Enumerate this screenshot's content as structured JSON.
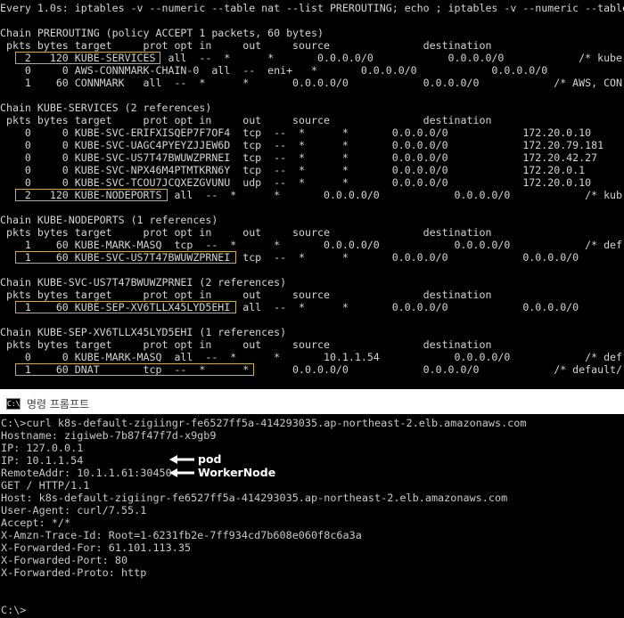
{
  "top_terminal": {
    "lines": [
      "Every 1.0s: iptables -v --numeric --table nat --list PREROUTING; echo ; iptables -v --numeric --table nat",
      "",
      "Chain PREROUTING (policy ACCEPT 1 packets, 60 bytes)",
      " pkts bytes target     prot opt in     out     source               destination",
      "    2   120 KUBE-SERVICES  all  --  *      *       0.0.0.0/0            0.0.0.0/0            /* kube",
      "    0     0 AWS-CONNMARK-CHAIN-0  all  --  eni+   *       0.0.0.0/0            0.0.0.0/0",
      "    1    60 CONNMARK   all  --  *      *       0.0.0.0/0            0.0.0.0/0            /* AWS, CON",
      "",
      "Chain KUBE-SERVICES (2 references)",
      " pkts bytes target     prot opt in     out     source               destination",
      "    0     0 KUBE-SVC-ERIFXISQEP7F7OF4  tcp  --  *      *       0.0.0.0/0            172.20.0.10",
      "    0     0 KUBE-SVC-UAGC4PYEYZJJEW6D  tcp  --  *      *       0.0.0.0/0            172.20.79.181",
      "    0     0 KUBE-SVC-US7T47BWUWZPRNEI  tcp  --  *      *       0.0.0.0/0            172.20.42.27",
      "    0     0 KUBE-SVC-NPX46M4PTMTKRN6Y  tcp  --  *      *       0.0.0.0/0            172.20.0.1",
      "    0     0 KUBE-SVC-TCOU7JCQXEZGVUNU  udp  --  *      *       0.0.0.0/0            172.20.0.10",
      "    2   120 KUBE-NODEPORTS  all  --  *      *       0.0.0.0/0            0.0.0.0/0            /* kub",
      "",
      "Chain KUBE-NODEPORTS (1 references)",
      " pkts bytes target     prot opt in     out     source               destination",
      "    1    60 KUBE-MARK-MASQ  tcp  --  *      *       0.0.0.0/0            0.0.0.0/0            /* def",
      "    1    60 KUBE-SVC-US7T47BWUWZPRNEI  tcp  --  *      *       0.0.0.0/0            0.0.0.0/0",
      "",
      "Chain KUBE-SVC-US7T47BWUWZPRNEI (2 references)",
      " pkts bytes target     prot opt in     out     source               destination",
      "    1    60 KUBE-SEP-XV6TLLX45LYD5EHI  all  --  *      *       0.0.0.0/0            0.0.0.0/0",
      "",
      "Chain KUBE-SEP-XV6TLLX45LYD5EHI (1 references)",
      " pkts bytes target     prot opt in     out     source               destination",
      "    0     0 KUBE-MARK-MASQ  all  --  *      *       10.1.1.54            0.0.0.0/0            /* def",
      "    1    60 DNAT       tcp  --  *      *       0.0.0.0/0            0.0.0.0/0            /* default/"
    ]
  },
  "cmd_window": {
    "title": "명령 프롬프트",
    "icon_label": "C:\\",
    "lines": [
      "C:\\>curl k8s-default-zigiingr-fe6527ff5a-414293035.ap-northeast-2.elb.amazonaws.com",
      "Hostname: zigiweb-7b87f47f7d-x9gb9",
      "IP: 127.0.0.1",
      "IP: 10.1.1.54",
      "RemoteAddr: 10.1.1.61:30450",
      "GET / HTTP/1.1",
      "Host: k8s-default-zigiingr-fe6527ff5a-414293035.ap-northeast-2.elb.amazonaws.com",
      "User-Agent: curl/7.55.1",
      "Accept: */*",
      "X-Amzn-Trace-Id: Root=1-6231fb2e-7ff934cd7b608e060f8c6a3a",
      "X-Forwarded-For: 61.101.113.35",
      "X-Forwarded-Port: 80",
      "X-Forwarded-Proto: http",
      "",
      "",
      "C:\\>"
    ],
    "annotations": [
      {
        "label": "pod"
      },
      {
        "label": "WorkerNode"
      }
    ]
  },
  "colors": {
    "terminal_bg": "#000000",
    "terminal_text": "#d4d4d4",
    "highlight_box": "#c7b13a",
    "arrow": "#ffffff"
  }
}
